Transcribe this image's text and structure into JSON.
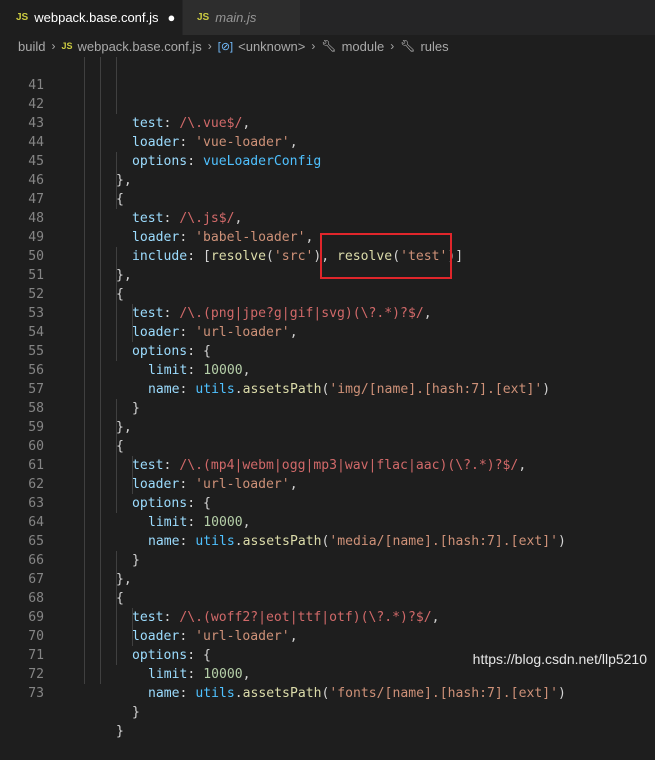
{
  "tabs": [
    {
      "badge": "JS",
      "label": "webpack.base.conf.js",
      "dirty": "●"
    },
    {
      "badge": "JS",
      "label": "main.js"
    }
  ],
  "breadcrumb": {
    "folder": "build",
    "file_badge": "JS",
    "file": "webpack.base.conf.js",
    "object_icon": "[⊘]",
    "unknown": "<unknown>",
    "module": "module",
    "rules": "rules",
    "separator": "›"
  },
  "lines": [
    {
      "n": "41"
    },
    {
      "n": "42"
    },
    {
      "n": "43"
    },
    {
      "n": "44"
    },
    {
      "n": "45"
    },
    {
      "n": "46"
    },
    {
      "n": "47"
    },
    {
      "n": "48"
    },
    {
      "n": "49"
    },
    {
      "n": "50"
    },
    {
      "n": "51"
    },
    {
      "n": "52"
    },
    {
      "n": "53"
    },
    {
      "n": "54"
    },
    {
      "n": "55"
    },
    {
      "n": "56"
    },
    {
      "n": "57"
    },
    {
      "n": "58"
    },
    {
      "n": "59"
    },
    {
      "n": "60"
    },
    {
      "n": "61"
    },
    {
      "n": "62"
    },
    {
      "n": "63"
    },
    {
      "n": "64"
    },
    {
      "n": "65"
    },
    {
      "n": "66"
    },
    {
      "n": "67"
    },
    {
      "n": "68"
    },
    {
      "n": "69"
    },
    {
      "n": "70"
    },
    {
      "n": "71"
    },
    {
      "n": "72"
    },
    {
      "n": "73"
    }
  ],
  "code": {
    "l41": {
      "k": "test",
      "re": "/\\.vue$/",
      "end": ","
    },
    "l42": {
      "k": "loader",
      "s": "'vue-loader'",
      "end": ","
    },
    "l43": {
      "k": "options",
      "v": "vueLoaderConfig"
    },
    "l44": "},",
    "l45": "{",
    "l46": {
      "k": "test",
      "re": "/\\.js$/",
      "end": ","
    },
    "l47": {
      "k": "loader",
      "s": "'babel-loader'",
      "end": ","
    },
    "l48": {
      "k": "include",
      "fn1": "resolve",
      "s1": "'src'",
      "fn2": "resolve",
      "s2": "'test'"
    },
    "l49": "},",
    "l50": "{",
    "l51": {
      "k": "test",
      "re": "/\\.(png|jpe?g|gif|svg)(\\?.*)?$/",
      "end": ","
    },
    "l52": {
      "k": "loader",
      "s": "'url-loader'",
      "end": ","
    },
    "l53": {
      "k": "options",
      "end": "{"
    },
    "l54": {
      "k": "limit",
      "num": "10000",
      "end": ","
    },
    "l55": {
      "k": "name",
      "obj": "utils",
      "fn": "assetsPath",
      "s": "'img/[name].[hash:7].[ext]'"
    },
    "l56": "}",
    "l57": "},",
    "l58": "{",
    "l59": {
      "k": "test",
      "re": "/\\.(mp4|webm|ogg|mp3|wav|flac|aac)(\\?.*)?$/",
      "end": ","
    },
    "l60": {
      "k": "loader",
      "s": "'url-loader'",
      "end": ","
    },
    "l61": {
      "k": "options",
      "end": "{"
    },
    "l62": {
      "k": "limit",
      "num": "10000",
      "end": ","
    },
    "l63": {
      "k": "name",
      "obj": "utils",
      "fn": "assetsPath",
      "s": "'media/[name].[hash:7].[ext]'"
    },
    "l64": "}",
    "l65": "},",
    "l66": "{",
    "l67": {
      "k": "test",
      "re": "/\\.(woff2?|eot|ttf|otf)(\\?.*)?$/",
      "end": ","
    },
    "l68": {
      "k": "loader",
      "s": "'url-loader'",
      "end": ","
    },
    "l69": {
      "k": "options",
      "end": "{"
    },
    "l70": {
      "k": "limit",
      "num": "10000",
      "end": ","
    },
    "l71": {
      "k": "name",
      "obj": "utils",
      "fn": "assetsPath",
      "s": "'fonts/[name].[hash:7].[ext]'"
    },
    "l72": "}",
    "l73": "}"
  },
  "watermark": "https://blog.csdn.net/llp5210",
  "colors": {
    "highlight_box": "#e0262b",
    "js_badge": "#cbcb41",
    "editor_bg": "#1e1e1e"
  }
}
